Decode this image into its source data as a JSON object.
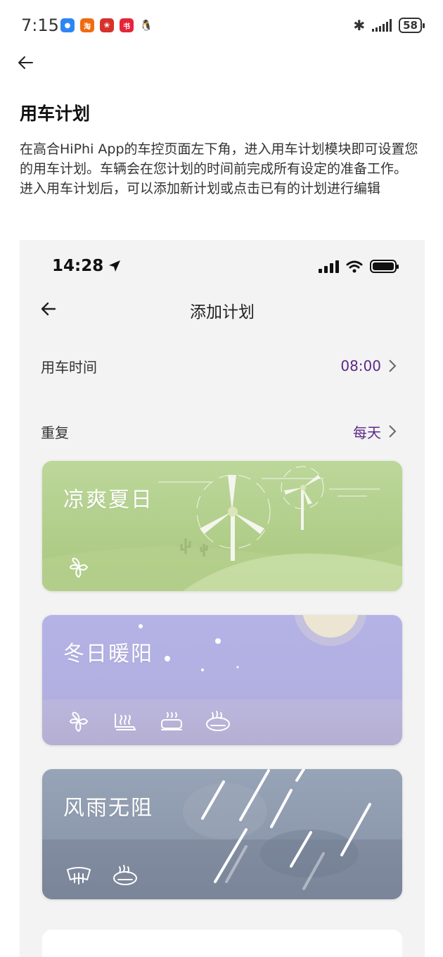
{
  "status_bar": {
    "time": "7:15",
    "battery": "58",
    "notifications": [
      {
        "name": "message-icon",
        "color": "#2e86f5",
        "glyph": "●"
      },
      {
        "name": "taobao-icon",
        "color": "#f06a10",
        "glyph": "淘"
      },
      {
        "name": "flower-app-icon",
        "color": "#d6312b",
        "glyph": "❀"
      },
      {
        "name": "xiaohongshu-icon",
        "color": "#e6243a",
        "glyph": "书"
      },
      {
        "name": "qq-icon",
        "color": "#222222",
        "glyph": "🐧"
      }
    ]
  },
  "page": {
    "title": "用车计划",
    "paragraphs": [
      "在高合HiPhi App的车控页面左下角，进入用车计划模块即可设置您的用车计划。车辆会在您计划的时间前完成所有设定的准备工作。",
      "进入用车计划后，可以添加新计划或点击已有的计划进行编辑"
    ]
  },
  "screenshot": {
    "status_time": "14:28",
    "header_title": "添加计划",
    "time_row": {
      "label": "用车时间",
      "value": "08:00"
    },
    "repeat_row": {
      "label": "重复",
      "value": "每天"
    },
    "accent_color": "#5b2a86",
    "cards": [
      {
        "name": "凉爽夏日",
        "icons": [
          "fan-icon"
        ]
      },
      {
        "name": "冬日暖阳",
        "icons": [
          "fan-icon",
          "seat-heat-icon",
          "seat-vent-icon",
          "steering-heat-icon"
        ]
      },
      {
        "name": "风雨无阻",
        "icons": [
          "rear-defrost-icon",
          "steering-heat-icon"
        ]
      }
    ]
  }
}
